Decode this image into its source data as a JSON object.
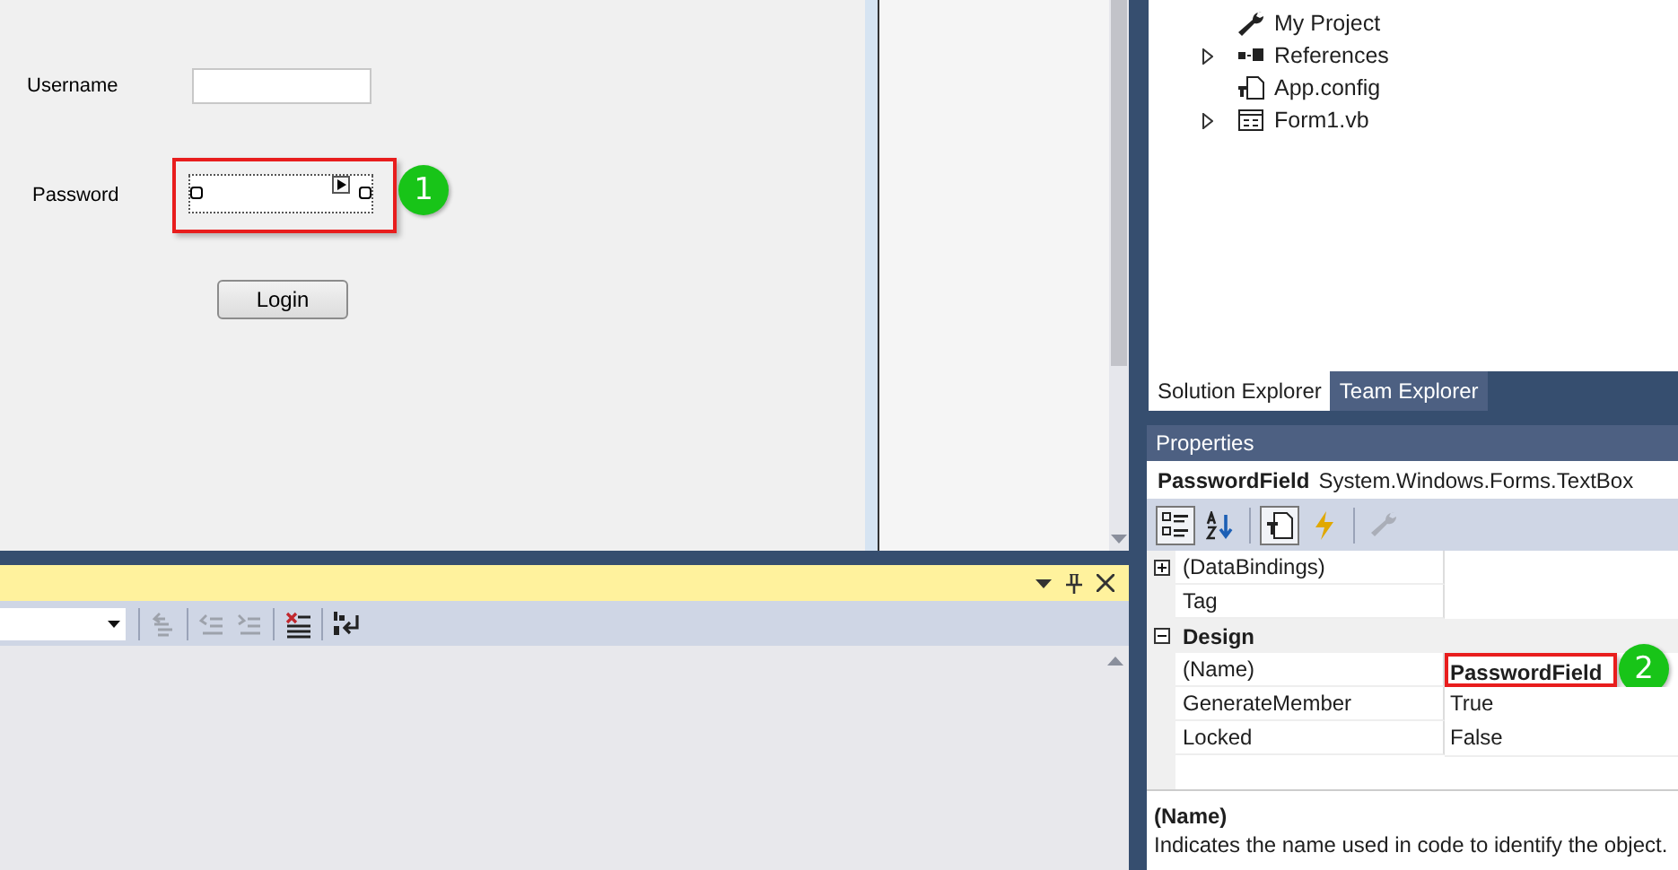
{
  "designer": {
    "fields": [
      {
        "label": "Username",
        "selected": false
      },
      {
        "label": "Password",
        "selected": true,
        "callout": "1"
      }
    ],
    "button": "Login"
  },
  "output_pane": {
    "tools": [
      {
        "kind": "go-back",
        "disabled": true
      },
      {
        "kind": "outdent",
        "disabled": true
      },
      {
        "kind": "indent",
        "disabled": true
      },
      {
        "kind": "clear",
        "disabled": false
      },
      {
        "kind": "wrap",
        "disabled": false
      }
    ]
  },
  "solution_explorer": {
    "items": [
      {
        "label": "My Project",
        "kind": "wrench",
        "expandable": false
      },
      {
        "label": "References",
        "kind": "references",
        "expandable": true
      },
      {
        "label": "App.config",
        "kind": "config",
        "expandable": false
      },
      {
        "label": "Form1.vb",
        "kind": "form",
        "expandable": true
      }
    ],
    "tabs": [
      {
        "label": "Solution Explorer",
        "selected": true
      },
      {
        "label": "Team Explorer",
        "selected": false
      }
    ]
  },
  "properties": {
    "title": "Properties",
    "object_name": "PasswordField",
    "object_type": "System.Windows.Forms.TextBox",
    "tools": [
      {
        "kind": "categorized",
        "selected": true,
        "disabled": false
      },
      {
        "kind": "alphabetical",
        "selected": false,
        "disabled": false
      },
      {
        "kind": "properties",
        "selected": true,
        "disabled": false
      },
      {
        "kind": "events",
        "selected": false,
        "disabled": false
      },
      {
        "kind": "property-pages",
        "selected": false,
        "disabled": true
      }
    ],
    "rows": [
      {
        "kind": "expandable",
        "name": "(DataBindings)",
        "expanded": false
      },
      {
        "kind": "property",
        "name": "Tag"
      },
      {
        "kind": "category",
        "name": "Design",
        "expanded": true
      },
      {
        "kind": "property",
        "name": "(Name)",
        "value": "PasswordField",
        "bold": true,
        "callout": "2"
      },
      {
        "kind": "property",
        "name": "GenerateMember",
        "value": "True",
        "bold": false
      },
      {
        "kind": "property",
        "name": "Locked",
        "value": "False",
        "bold": false
      }
    ],
    "description": {
      "title": "(Name)",
      "text": "Indicates the name used in code to identify the object."
    }
  }
}
